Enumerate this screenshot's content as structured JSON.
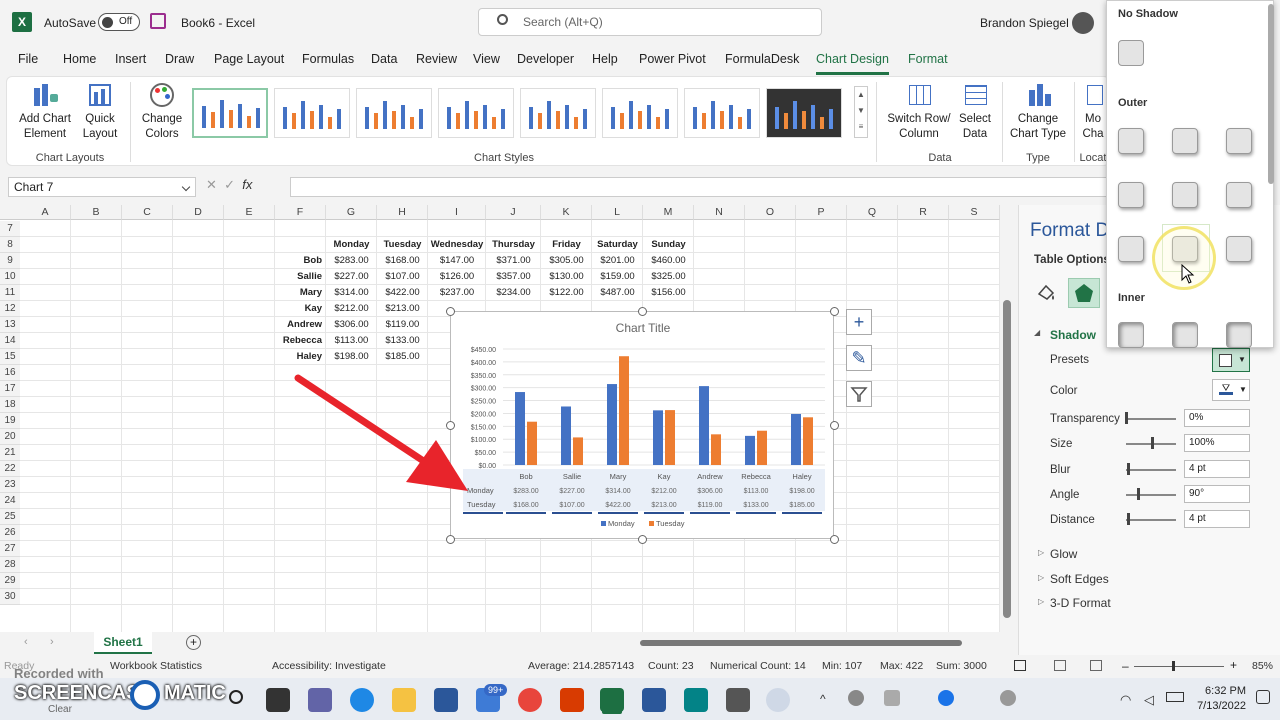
{
  "title_bar": {
    "autosave_label": "AutoSave",
    "toggle_state": "Off",
    "doc_title": "Book6 - Excel",
    "search_placeholder": "Search (Alt+Q)",
    "user_name": "Brandon Spiegel"
  },
  "menu": [
    "File",
    "Home",
    "Insert",
    "Draw",
    "Page Layout",
    "Formulas",
    "Data",
    "Review",
    "View",
    "Developer",
    "Help",
    "Power Pivot",
    "FormulaDesk",
    "Chart Design",
    "Format"
  ],
  "ribbon": {
    "add_chart_element": "Add Chart Element",
    "quick_layout": "Quick Layout",
    "chart_layouts_group": "Chart Layouts",
    "change_colors": "Change Colors",
    "chart_styles_group": "Chart Styles",
    "switch_row_column": "Switch Row/ Column",
    "select_data": "Select Data",
    "data_group": "Data",
    "change_chart_type": "Change Chart Type",
    "type_group": "Type",
    "move_chart": "Mo Cha",
    "location_group": "Locat"
  },
  "formula_bar": {
    "name_box": "Chart 7",
    "fx": "fx"
  },
  "columns": [
    "A",
    "B",
    "C",
    "D",
    "E",
    "F",
    "G",
    "H",
    "I",
    "J",
    "K",
    "L",
    "M",
    "N",
    "O",
    "P",
    "Q",
    "R",
    "S"
  ],
  "rows": [
    "7",
    "8",
    "9",
    "10",
    "11",
    "12",
    "13",
    "14",
    "15",
    "16",
    "17",
    "18",
    "19",
    "20",
    "21",
    "22",
    "23",
    "24",
    "25",
    "26",
    "27",
    "28",
    "29",
    "30"
  ],
  "table": {
    "headers": [
      "Monday",
      "Tuesday",
      "Wednesday",
      "Thursday",
      "Friday",
      "Saturday",
      "Sunday"
    ],
    "rows": [
      {
        "name": "Bob",
        "values": [
          "$283.00",
          "$168.00",
          "$147.00",
          "$371.00",
          "$305.00",
          "$201.00",
          "$460.00"
        ]
      },
      {
        "name": "Sallie",
        "values": [
          "$227.00",
          "$107.00",
          "$126.00",
          "$357.00",
          "$130.00",
          "$159.00",
          "$325.00"
        ]
      },
      {
        "name": "Mary",
        "values": [
          "$314.00",
          "$422.00",
          "$237.00",
          "$234.00",
          "$122.00",
          "$487.00",
          "$156.00"
        ]
      },
      {
        "name": "Kay",
        "values": [
          "$212.00",
          "$213.00",
          "",
          "",
          "",
          "",
          ""
        ]
      },
      {
        "name": "Andrew",
        "values": [
          "$306.00",
          "$119.00",
          "",
          "",
          "",
          "",
          ""
        ]
      },
      {
        "name": "Rebecca",
        "values": [
          "$113.00",
          "$133.00",
          "",
          "",
          "",
          "",
          ""
        ]
      },
      {
        "name": "Haley",
        "values": [
          "$198.00",
          "$185.00",
          "",
          "",
          "",
          "",
          ""
        ]
      }
    ]
  },
  "chart_data": {
    "type": "bar",
    "title": "Chart Title",
    "categories": [
      "Bob",
      "Sallie",
      "Mary",
      "Kay",
      "Andrew",
      "Rebecca",
      "Haley"
    ],
    "series": [
      {
        "name": "Monday",
        "values": [
          283,
          227,
          314,
          212,
          306,
          113,
          198
        ],
        "color": "#4472c4"
      },
      {
        "name": "Tuesday",
        "values": [
          168,
          107,
          422,
          213,
          119,
          133,
          185
        ],
        "color": "#ed7d31"
      }
    ],
    "yticks": [
      "$0.00",
      "$50.00",
      "$100.00",
      "$150.00",
      "$200.00",
      "$250.00",
      "$300.00",
      "$350.00",
      "$400.00",
      "$450.00"
    ],
    "ylim": [
      0,
      450
    ],
    "data_table_labels": [
      "Monday",
      "Tuesday"
    ],
    "data_table_rows": [
      [
        "$283.00",
        "$227.00",
        "$314.00",
        "$212.00",
        "$306.00",
        "$113.00",
        "$198.00"
      ],
      [
        "$168.00",
        "$107.00",
        "$422.00",
        "$213.00",
        "$119.00",
        "$133.00",
        "$185.00"
      ]
    ],
    "legend": "bottom",
    "grid": true
  },
  "sheet_tab": "Sheet1",
  "status": {
    "ready": "Ready",
    "accessibility_text": "Workbook Statistics",
    "accessibility": "Accessibility: Investigate",
    "average": "Average: 214.2857143",
    "count": "Count: 23",
    "numerical_count": "Numerical Count: 14",
    "min": "Min: 107",
    "max": "Max: 422",
    "sum": "Sum: 3000",
    "zoom": "85%"
  },
  "format_pane": {
    "title": "Format D",
    "tab": "Table Options",
    "shadow": "Shadow",
    "presets": "Presets",
    "color": "Color",
    "transparency": "Transparency",
    "transparency_val": "0%",
    "size": "Size",
    "size_val": "100%",
    "blur": "Blur",
    "blur_val": "4 pt",
    "angle": "Angle",
    "angle_val": "90°",
    "distance": "Distance",
    "distance_val": "4 pt",
    "glow": "Glow",
    "soft_edges": "Soft Edges",
    "three_d": "3-D Format"
  },
  "shadow_gallery": {
    "no_shadow": "No Shadow",
    "outer": "Outer",
    "inner": "Inner"
  },
  "taskbar": {
    "time": "6:32 PM",
    "date": "7/13/2022",
    "badge": "99+",
    "watermark": "SCREENCAST",
    "watermark2": "MATIC",
    "recorded": "Recorded with",
    "clear": "Clear"
  }
}
